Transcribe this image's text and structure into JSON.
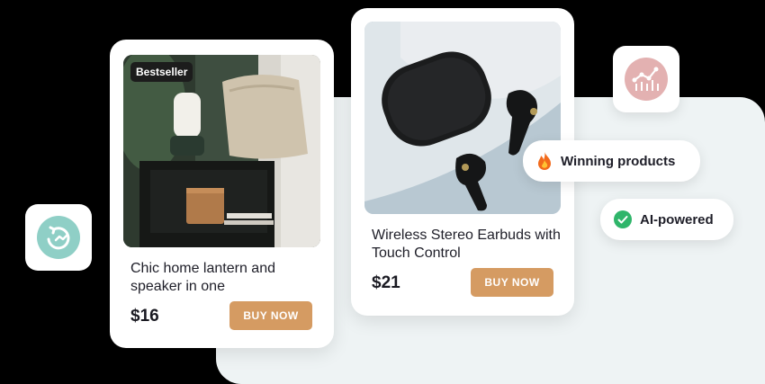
{
  "products": [
    {
      "badge": "Bestseller",
      "title": "Chic home lantern and speaker in one",
      "price": "$16",
      "cta": "BUY NOW"
    },
    {
      "title": "Wireless Stereo Earbuds with Touch Control",
      "price": "$21",
      "cta": "BUY NOW"
    }
  ],
  "tags": {
    "winning": {
      "label": "Winning products",
      "icon": "fire-icon"
    },
    "ai": {
      "label": "AI-powered",
      "icon": "check-circle-icon"
    }
  },
  "tiles": {
    "left_icon": "refresh-logo-icon",
    "right_icon": "analytics-chart-icon"
  },
  "colors": {
    "accent": "#d59b62",
    "panel": "#eef3f4",
    "check": "#2fb56a",
    "teal": "#8fcfc6",
    "pink": "#e3b1b1"
  }
}
